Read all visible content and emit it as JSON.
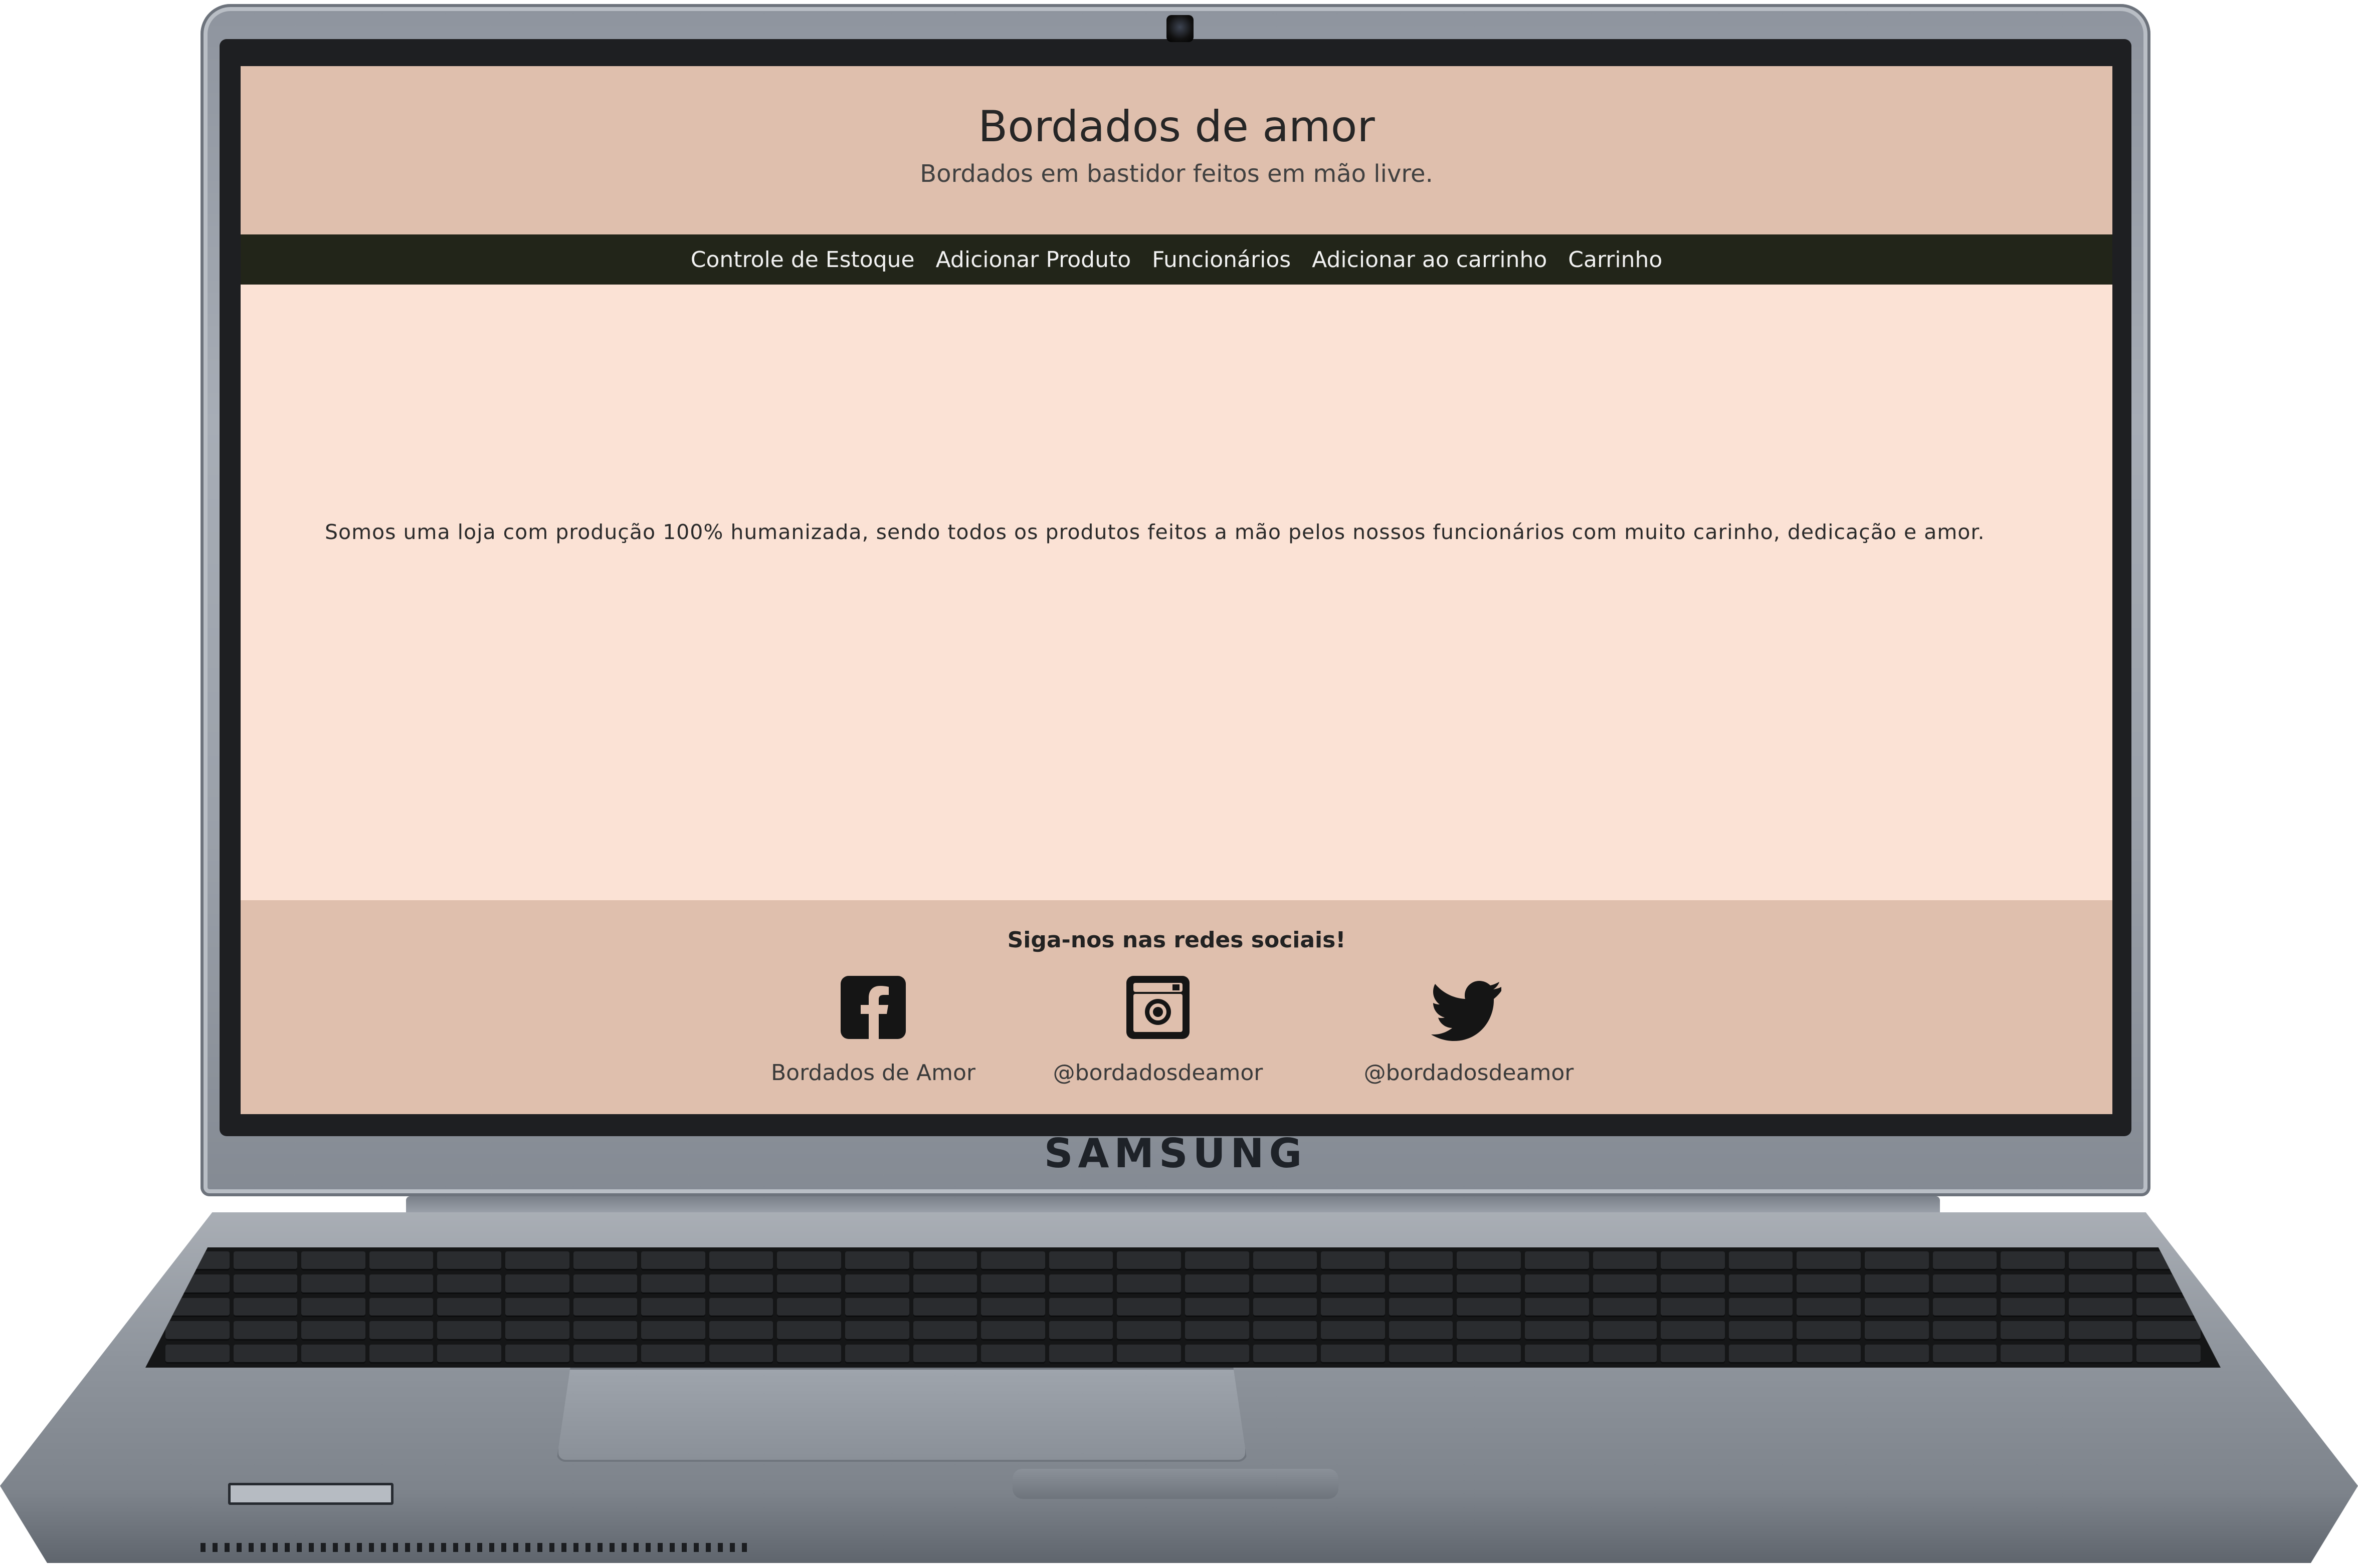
{
  "device": {
    "brand": "SAMSUNG"
  },
  "site": {
    "header": {
      "title": "Bordados de amor",
      "subtitle": "Bordados em bastidor feitos em mão livre."
    },
    "nav": {
      "items": [
        {
          "label": "Controle de Estoque"
        },
        {
          "label": "Adicionar Produto"
        },
        {
          "label": "Funcionários"
        },
        {
          "label": "Adicionar ao carrinho"
        },
        {
          "label": "Carrinho"
        }
      ]
    },
    "main": {
      "intro": "Somos uma loja com produção 100% humanizada, sendo todos os produtos feitos a mão pelos nossos funcionários com muito carinho, dedicação e amor."
    },
    "footer": {
      "heading": "Siga-nos nas redes sociais!",
      "socials": [
        {
          "icon": "facebook-icon",
          "label": "Bordados de Amor"
        },
        {
          "icon": "instagram-icon",
          "label": "@bordadosdeamor"
        },
        {
          "icon": "twitter-icon",
          "label": "@bordadosdeamor"
        }
      ]
    }
  },
  "colors": {
    "header_bg": "#dfbfad",
    "nav_bg": "#222519",
    "main_bg": "#fbe2d5",
    "footer_bg": "#dfbfad"
  }
}
